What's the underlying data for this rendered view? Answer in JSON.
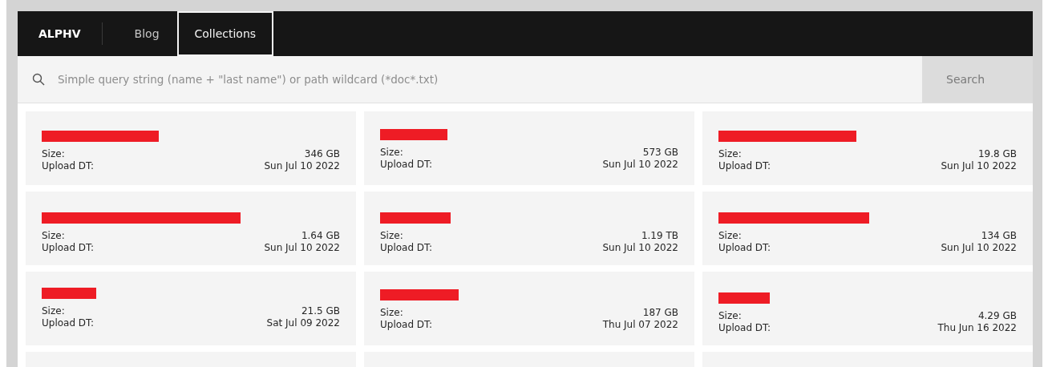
{
  "nav": {
    "brand": "ALPHV",
    "tabs": [
      {
        "label": "Blog",
        "selected": false
      },
      {
        "label": "Collections",
        "selected": true
      }
    ]
  },
  "search": {
    "placeholder": "Simple query string (name + \"last name\") or path wildcard (*doc*.txt)",
    "button": "Search"
  },
  "cards": [
    {
      "redacted": true,
      "size_label": "Size:",
      "size": "346 GB",
      "date_label": "Upload DT:",
      "date": "Sun Jul 10 2022"
    },
    {
      "redacted": true,
      "size_label": "Size:",
      "size": "573 GB",
      "date_label": "Upload DT:",
      "date": "Sun Jul 10 2022"
    },
    {
      "redacted": true,
      "size_label": "Size:",
      "size": "19.8 GB",
      "date_label": "Upload DT:",
      "date": "Sun Jul 10 2022"
    },
    {
      "redacted": true,
      "size_label": "Size:",
      "size": "1.64 GB",
      "date_label": "Upload DT:",
      "date": "Sun Jul 10 2022"
    },
    {
      "redacted": true,
      "size_label": "Size:",
      "size": "1.19 TB",
      "date_label": "Upload DT:",
      "date": "Sun Jul 10 2022"
    },
    {
      "redacted": true,
      "size_label": "Size:",
      "size": "134 GB",
      "date_label": "Upload DT:",
      "date": "Sun Jul 10 2022"
    },
    {
      "redacted": true,
      "size_label": "Size:",
      "size": "21.5 GB",
      "date_label": "Upload DT:",
      "date": "Sat Jul 09 2022"
    },
    {
      "redacted": true,
      "size_label": "Size:",
      "size": "187 GB",
      "date_label": "Upload DT:",
      "date": "Thu Jul 07 2022"
    },
    {
      "redacted": true,
      "size_label": "Size:",
      "size": "4.29 GB",
      "date_label": "Upload DT:",
      "date": "Thu Jun 16 2022"
    }
  ]
}
